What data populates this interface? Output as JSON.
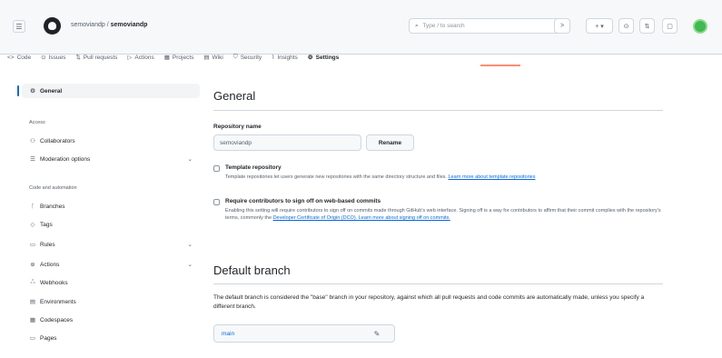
{
  "header": {
    "owner": "semoviandp",
    "separator": "/",
    "repo": "semoviandp",
    "search_placeholder": "Type / to search"
  },
  "repo_tabs": [
    {
      "icon": "code-icon",
      "glyph": "<>",
      "label": "Code"
    },
    {
      "icon": "issues-icon",
      "glyph": "⊙",
      "label": "Issues"
    },
    {
      "icon": "pull-request-icon",
      "glyph": "⇅",
      "label": "Pull requests"
    },
    {
      "icon": "actions-icon",
      "glyph": "▷",
      "label": "Actions"
    },
    {
      "icon": "projects-icon",
      "glyph": "▦",
      "label": "Projects"
    },
    {
      "icon": "wiki-icon",
      "glyph": "▤",
      "label": "Wiki"
    },
    {
      "icon": "security-icon",
      "glyph": "⛉",
      "label": "Security"
    },
    {
      "icon": "insights-icon",
      "glyph": "⌇",
      "label": "Insights"
    },
    {
      "icon": "settings-icon",
      "glyph": "⚙",
      "label": "Settings",
      "active": true
    }
  ],
  "sidebar": {
    "general": "General",
    "access_heading": "Access",
    "collaborators": "Collaborators",
    "moderation": "Moderation options",
    "code_heading": "Code and automation",
    "branches": "Branches",
    "tags": "Tags",
    "rules": "Rules",
    "actions": "Actions",
    "webhooks": "Webhooks",
    "environments": "Environments",
    "codespaces": "Codespaces",
    "pages": "Pages"
  },
  "main": {
    "title": "General",
    "repo_name_label": "Repository name",
    "repo_name_value": "semoviandp",
    "rename_button": "Rename",
    "template": {
      "title": "Template repository",
      "desc": "Template repositories let users generate new repositories with the same directory structure and files.",
      "link": "Learn more about template repositories"
    },
    "signoff": {
      "title": "Require contributors to sign off on web-based commits",
      "desc": "Enabling this setting will require contributors to sign off on commits made through GitHub's web interface. Signing off is a way for contributors to affirm that their commit complies with the repository's terms, commonly the",
      "link": "Developer Certificate of Origin (DCO). Learn more about signing off on commits."
    },
    "default_branch_title": "Default branch",
    "default_branch_desc": "The default branch is considered the \"base\" branch in your repository, against which all pull requests and code commits are automatically made, unless you specify a different branch.",
    "branch_name": "main"
  },
  "colors": {
    "accent": "#0969da",
    "tab_underline": "#fd8c73",
    "avatar": "#3fb950"
  }
}
